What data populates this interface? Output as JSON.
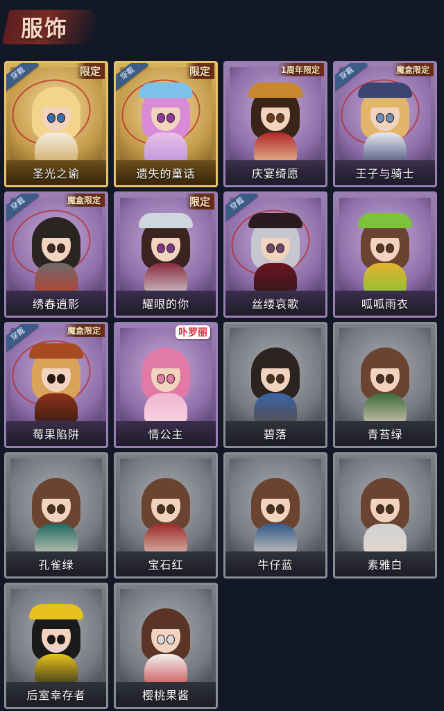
{
  "header": {
    "title": "服饰"
  },
  "colors": {
    "background": "#121826",
    "gold_frame": "#e6c36a",
    "purple_frame": "#9a7fb3",
    "gray_frame": "#8a8e94",
    "worn_badge": "#3c5c88",
    "limit_badge_text": "#f5e3b8"
  },
  "costumes": [
    {
      "name": "圣光之谕",
      "rarity": "gold",
      "worn_badge": "穿戴",
      "tag": "限定",
      "hair": "#f2d58a",
      "outfit": "#f2ece0",
      "accent": "#c9a24c",
      "hat": "",
      "circled": true,
      "eyes": "#3a6ea8"
    },
    {
      "name": "遗失的童话",
      "rarity": "gold",
      "worn_badge": "穿戴",
      "tag": "限定",
      "hair": "#d98bd8",
      "outfit": "#e8c1e8",
      "accent": "#b48ad8",
      "hat": "#7dc2e8",
      "circled": true,
      "eyes": "#8a3ba0"
    },
    {
      "name": "庆宴绮愿",
      "rarity": "purple",
      "worn_badge": "",
      "tag": "1周年限定",
      "hair": "#3a2418",
      "outfit": "#b0282a",
      "accent": "#f2d6a8",
      "hat": "#c8862e",
      "circled": false,
      "eyes": "#6b3c1e"
    },
    {
      "name": "王子与骑士",
      "rarity": "purple",
      "worn_badge": "穿戴",
      "tag": "魔盒限定",
      "hair": "#e2b66a",
      "outfit": "#e6e9f0",
      "accent": "#2f3a66",
      "hat": "#3a4470",
      "circled": true,
      "eyes": "#6e8fb8"
    },
    {
      "name": "绣春逍影",
      "rarity": "purple",
      "worn_badge": "穿戴",
      "tag": "魔盒限定",
      "hair": "#2b2522",
      "outfit": "#6f6a68",
      "accent": "#c23a2a",
      "hat": "",
      "circled": true,
      "eyes": "#3a2a22"
    },
    {
      "name": "耀眼的你",
      "rarity": "purple",
      "worn_badge": "",
      "tag": "限定",
      "hair": "#3b2420",
      "outfit": "#8a2a3e",
      "accent": "#d9dee4",
      "hat": "#cfd6dd",
      "circled": false,
      "eyes": "#7a3a8a"
    },
    {
      "name": "丝缕哀歌",
      "rarity": "purple",
      "worn_badge": "穿戴",
      "tag": "",
      "hair": "#c6c6ce",
      "outfit": "#6a1420",
      "accent": "#2a1a1e",
      "hat": "#2a1a1e",
      "circled": true,
      "eyes": "#6a4a6a"
    },
    {
      "name": "呱呱雨衣",
      "rarity": "purple",
      "worn_badge": "",
      "tag": "",
      "hair": "#6a4430",
      "outfit": "#e6b32e",
      "accent": "#7cc23a",
      "hat": "#7cc23a",
      "circled": false,
      "eyes": "#5a3a26"
    },
    {
      "name": "莓果陷阱",
      "rarity": "purple",
      "worn_badge": "穿戴",
      "tag": "魔盒限定",
      "hair": "#d9a35a",
      "outfit": "#8a3218",
      "accent": "#2a1a14",
      "hat": "#a84a22",
      "circled": true,
      "eyes": "#2a1a14"
    },
    {
      "name": "情公主",
      "rarity": "purple",
      "worn_badge": "",
      "tag": "",
      "collab": "卟罗丽",
      "hair": "#e27aa8",
      "outfit": "#f0b6cf",
      "accent": "#f7dbe6",
      "hat": "",
      "circled": false,
      "eyes": "#e27aa8"
    },
    {
      "name": "碧落",
      "rarity": "gray",
      "worn_badge": "",
      "tag": "",
      "hair": "#2b2320",
      "outfit": "#3a63a8",
      "accent": "#5a4a3a",
      "hat": "",
      "circled": false,
      "eyes": "#4a3322"
    },
    {
      "name": "青苔绿",
      "rarity": "gray",
      "worn_badge": "",
      "tag": "",
      "hair": "#6a4430",
      "outfit": "#3f6a3a",
      "accent": "#e6d6c6",
      "hat": "",
      "circled": false,
      "eyes": "#4a3322"
    },
    {
      "name": "孔雀绿",
      "rarity": "gray",
      "worn_badge": "",
      "tag": "",
      "hair": "#6a4430",
      "outfit": "#1f6a62",
      "accent": "#e6d6c6",
      "hat": "",
      "circled": false,
      "eyes": "#4a3322"
    },
    {
      "name": "宝石红",
      "rarity": "gray",
      "worn_badge": "",
      "tag": "",
      "hair": "#6a4430",
      "outfit": "#9a2a2a",
      "accent": "#e6d6c6",
      "hat": "",
      "circled": false,
      "eyes": "#4a3322"
    },
    {
      "name": "牛仔蓝",
      "rarity": "gray",
      "worn_badge": "",
      "tag": "",
      "hair": "#6a4430",
      "outfit": "#345a8a",
      "accent": "#e6d6c6",
      "hat": "",
      "circled": false,
      "eyes": "#4a3322"
    },
    {
      "name": "素雅白",
      "rarity": "gray",
      "worn_badge": "",
      "tag": "",
      "hair": "#6a4430",
      "outfit": "#cfd2d6",
      "accent": "#e6d6c6",
      "hat": "",
      "circled": false,
      "eyes": "#4a3322"
    },
    {
      "name": "后室幸存者",
      "rarity": "gray",
      "worn_badge": "",
      "tag": "",
      "hair": "#1a1a1a",
      "outfit": "#e6c21e",
      "accent": "#1a1a1a",
      "hat": "#e6c21e",
      "circled": false,
      "eyes": "#1a1a1a"
    },
    {
      "name": "樱桃果酱",
      "rarity": "gray",
      "worn_badge": "",
      "tag": "",
      "hair": "#5a3424",
      "outfit": "#f2f0ee",
      "accent": "#c23a3a",
      "hat": "",
      "circled": false,
      "eyes": "#d8d8dc"
    }
  ]
}
